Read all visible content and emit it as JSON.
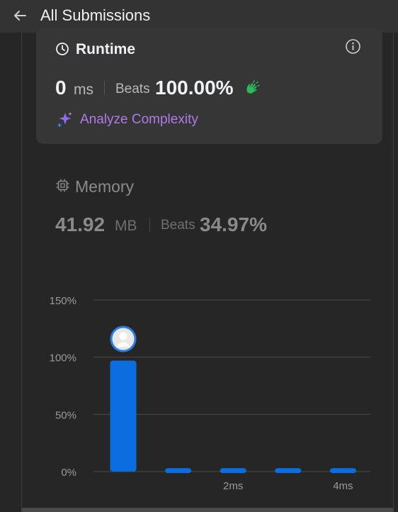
{
  "header": {
    "title": "All Submissions"
  },
  "runtime": {
    "title": "Runtime",
    "value": "0",
    "unit": "ms",
    "beats_label": "Beats",
    "beats_value": "100.00%",
    "analyze_label": "Analyze Complexity"
  },
  "memory": {
    "title": "Memory",
    "value": "41.92",
    "unit": "MB",
    "beats_label": "Beats",
    "beats_value": "34.97%"
  },
  "colors": {
    "accent_purple": "#b07be8",
    "bar_blue": "#0a6ee0",
    "clap_green": "#2cbb5d"
  },
  "chart_data": {
    "type": "bar",
    "y_ticks": [
      "150%",
      "100%",
      "50%",
      "0%"
    ],
    "ylim": [
      0,
      150
    ],
    "x_tick_labels": [
      {
        "index": 2,
        "label": "2ms"
      },
      {
        "index": 4,
        "label": "4ms"
      }
    ],
    "values": [
      97,
      3,
      3,
      3,
      3
    ],
    "user_marker_index": 0,
    "grid": true
  }
}
